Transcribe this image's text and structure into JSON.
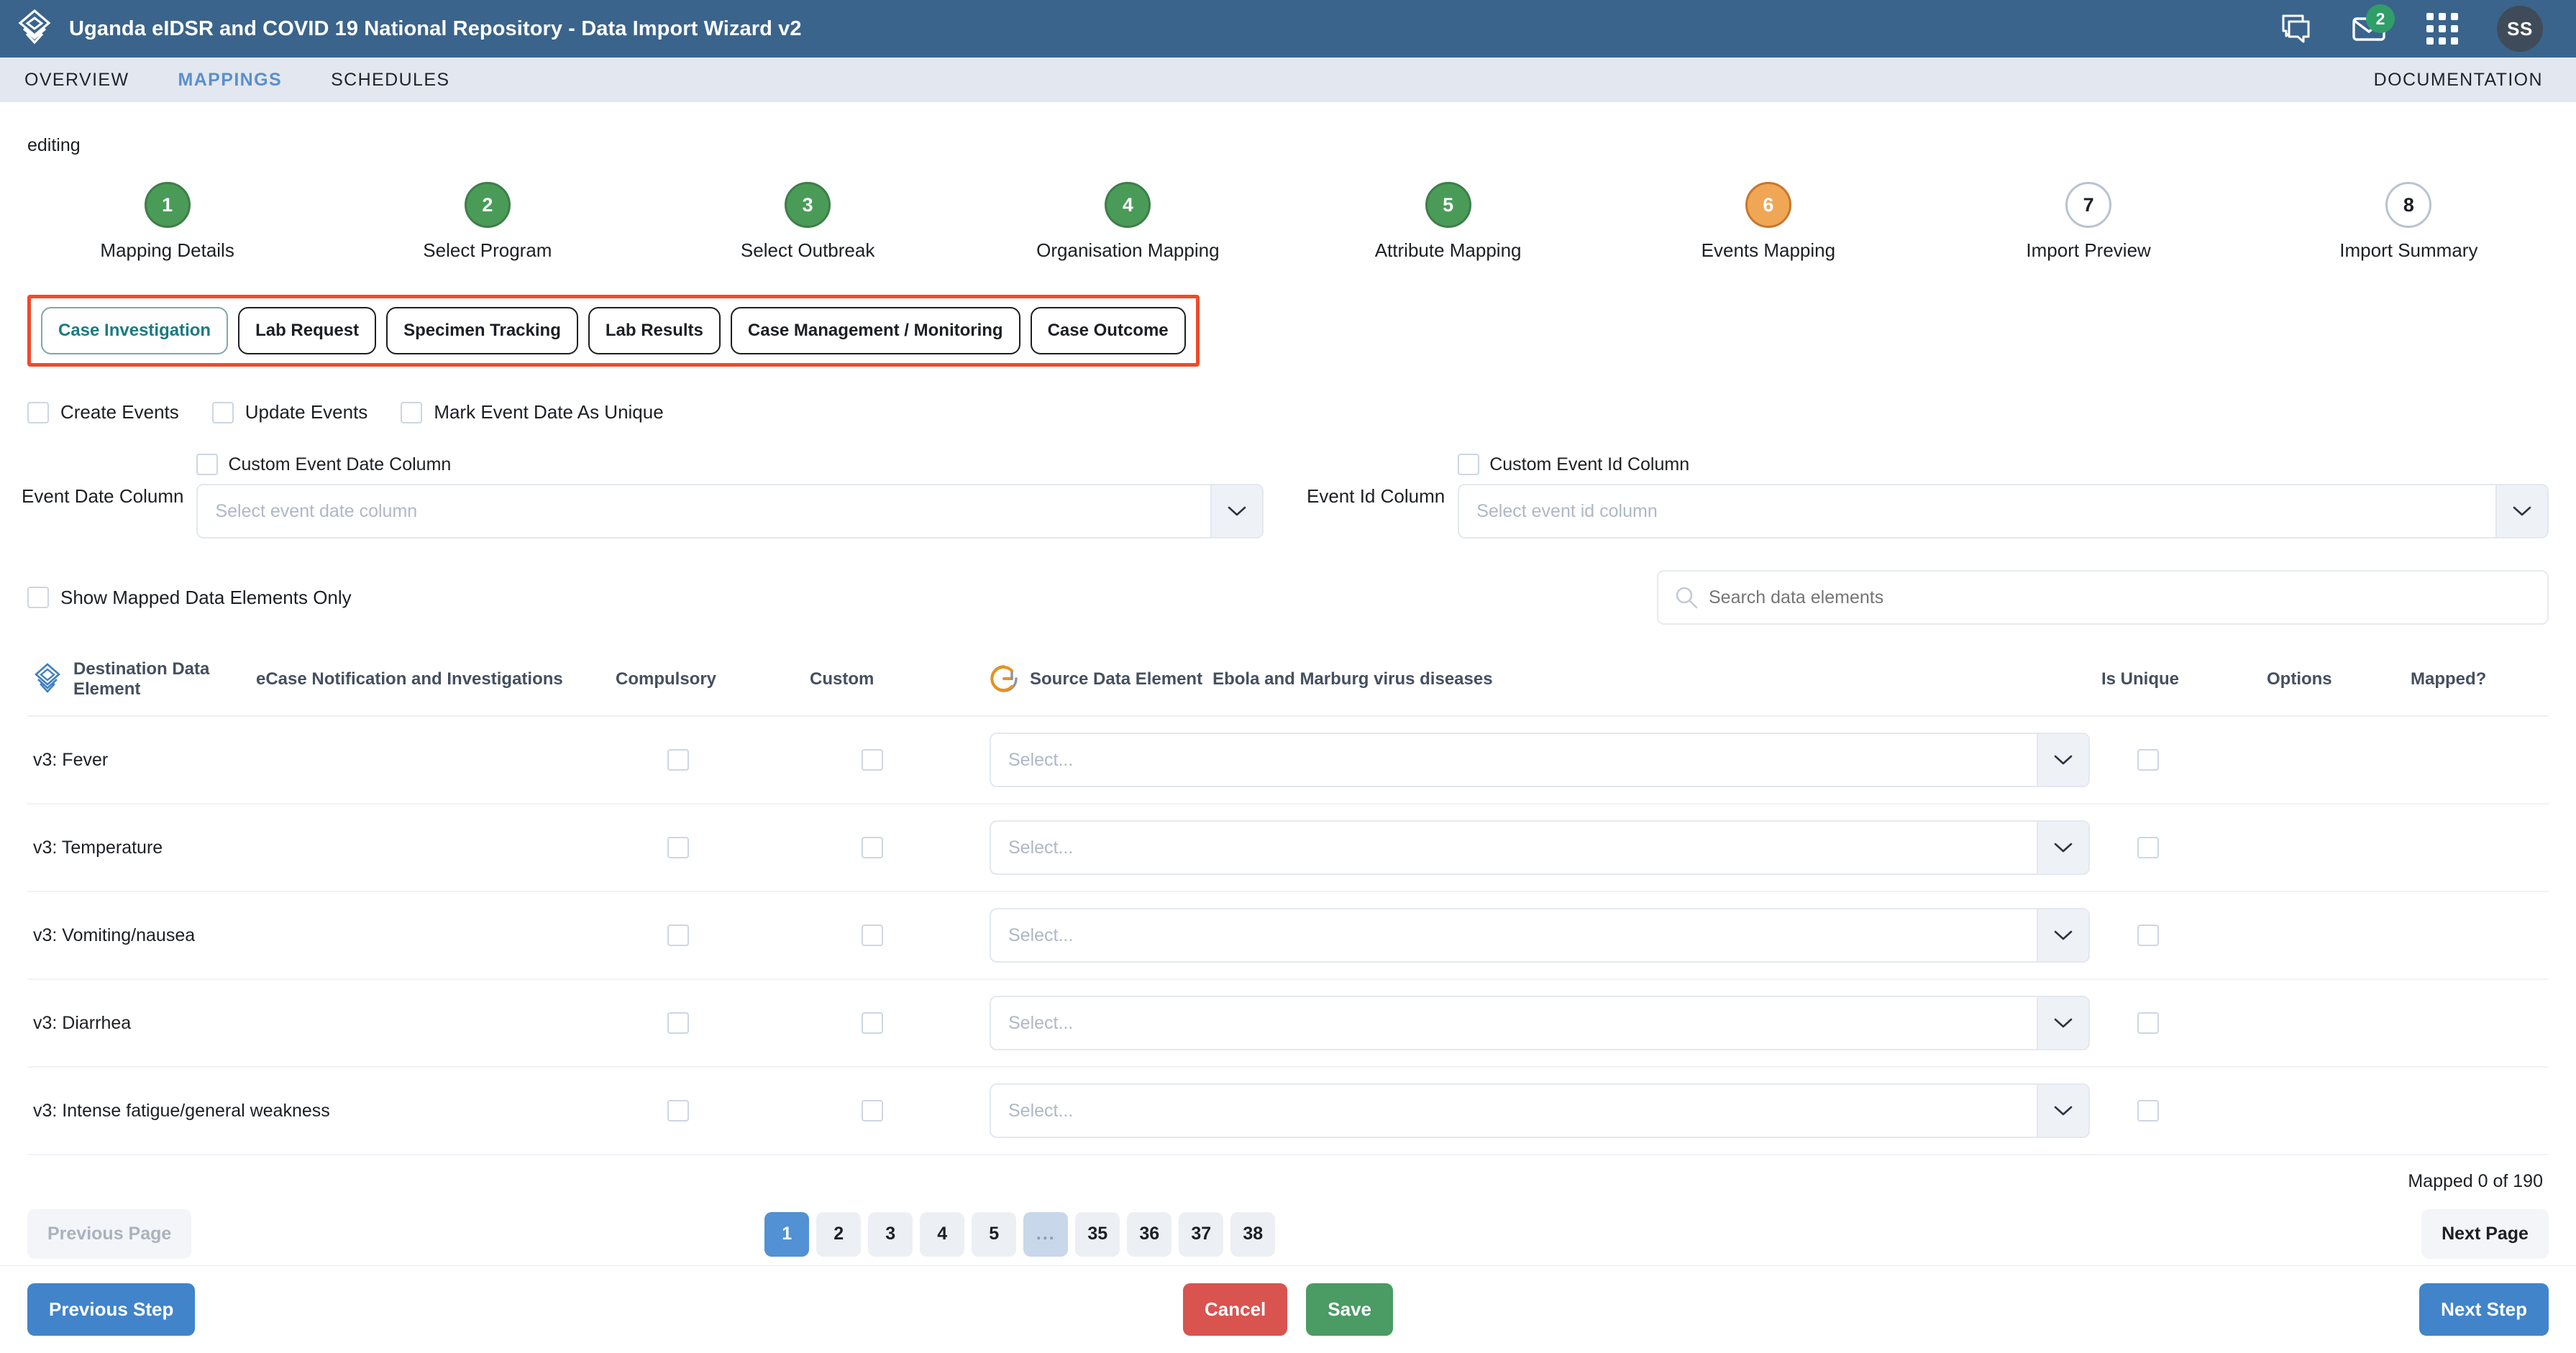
{
  "header": {
    "title": "Uganda eIDSR and COVID 19 National Repository - Data Import Wizard v2",
    "logo_icon": "dhis2-diamond-logo-icon",
    "chat_icon": "chat-bubble-icon",
    "mail_icon": "envelope-icon",
    "mail_badge": "2",
    "apps_icon": "apps-grid-icon",
    "avatar_initials": "SS"
  },
  "nav": {
    "items": [
      {
        "label": "OVERVIEW",
        "active": false
      },
      {
        "label": "MAPPINGS",
        "active": true
      },
      {
        "label": "SCHEDULES",
        "active": false
      }
    ],
    "documentation_label": "DOCUMENTATION"
  },
  "page": {
    "editing_label": "editing"
  },
  "stepper": {
    "steps": [
      {
        "number": "1",
        "label": "Mapping Details",
        "state": "done"
      },
      {
        "number": "2",
        "label": "Select Program",
        "state": "done"
      },
      {
        "number": "3",
        "label": "Select Outbreak",
        "state": "done"
      },
      {
        "number": "4",
        "label": "Organisation Mapping",
        "state": "done"
      },
      {
        "number": "5",
        "label": "Attribute Mapping",
        "state": "done"
      },
      {
        "number": "6",
        "label": "Events Mapping",
        "state": "active"
      },
      {
        "number": "7",
        "label": "Import Preview",
        "state": "todo"
      },
      {
        "number": "8",
        "label": "Import Summary",
        "state": "todo"
      }
    ]
  },
  "stage_tabs": {
    "highlight_color": "#f04a29",
    "items": [
      {
        "label": "Case Investigation",
        "selected": true
      },
      {
        "label": "Lab Request",
        "selected": false
      },
      {
        "label": "Specimen Tracking",
        "selected": false
      },
      {
        "label": "Lab Results",
        "selected": false
      },
      {
        "label": "Case Management / Monitoring",
        "selected": false
      },
      {
        "label": "Case Outcome",
        "selected": false
      }
    ]
  },
  "event_options": {
    "create_events_label": "Create Events",
    "update_events_label": "Update Events",
    "mark_unique_label": "Mark Event Date As Unique",
    "create_events_checked": false,
    "update_events_checked": false,
    "mark_unique_checked": false
  },
  "event_date": {
    "label": "Event Date Column",
    "custom_label": "Custom Event Date Column",
    "custom_checked": false,
    "placeholder": "Select event date column",
    "value": "",
    "chevron_icon": "chevron-down-icon"
  },
  "event_id": {
    "label": "Event Id Column",
    "custom_label": "Custom Event Id Column",
    "custom_checked": false,
    "placeholder": "Select event id column",
    "value": "",
    "chevron_icon": "chevron-down-icon"
  },
  "filters": {
    "show_mapped_only_label": "Show Mapped Data Elements Only",
    "show_mapped_only_checked": false,
    "search_placeholder": "Search data elements",
    "search_value": "",
    "search_icon": "search-icon"
  },
  "table": {
    "headers": {
      "destination": "Destination Data Element",
      "destination_icon": "dhis2-diamond-logo-icon",
      "ecase": "eCase Notification and Investigations",
      "compulsory": "Compulsory",
      "custom": "Custom",
      "source": "Source Data Element",
      "source_icon": "godata-logo-icon",
      "source_sub": "Ebola and Marburg virus diseases",
      "is_unique": "Is Unique",
      "options": "Options",
      "mapped": "Mapped?"
    },
    "select_placeholder": "Select...",
    "select_chevron_icon": "chevron-down-icon",
    "rows": [
      {
        "destination": "v3: Fever",
        "compulsory": false,
        "custom": false,
        "source": "",
        "is_unique": false
      },
      {
        "destination": "v3: Temperature",
        "compulsory": false,
        "custom": false,
        "source": "",
        "is_unique": false
      },
      {
        "destination": "v3: Vomiting/nausea",
        "compulsory": false,
        "custom": false,
        "source": "",
        "is_unique": false
      },
      {
        "destination": "v3: Diarrhea",
        "compulsory": false,
        "custom": false,
        "source": "",
        "is_unique": false
      },
      {
        "destination": "v3: Intense fatigue/general weakness",
        "compulsory": false,
        "custom": false,
        "source": "",
        "is_unique": false
      }
    ],
    "mapped_count": "Mapped 0 of 190"
  },
  "pagination": {
    "previous_page_label": "Previous Page",
    "next_page_label": "Next Page",
    "pages": [
      "1",
      "2",
      "3",
      "4",
      "5",
      "...",
      "35",
      "36",
      "37",
      "38"
    ],
    "active_page": "1"
  },
  "footer": {
    "previous_step_label": "Previous Step",
    "cancel_label": "Cancel",
    "save_label": "Save",
    "next_step_label": "Next Step"
  },
  "colors": {
    "header_blue": "#3a648c",
    "nav_bg": "#e3e7ef",
    "accent_blue": "#5b8fcc",
    "step_done_green": "#4a9b58",
    "step_active_orange": "#efa756",
    "highlight_red": "#f04a29",
    "selected_tab_teal": "#1b7a82",
    "cancel_red": "#d9534f",
    "save_green": "#4a9b64",
    "badge_green": "#2f9e69"
  }
}
